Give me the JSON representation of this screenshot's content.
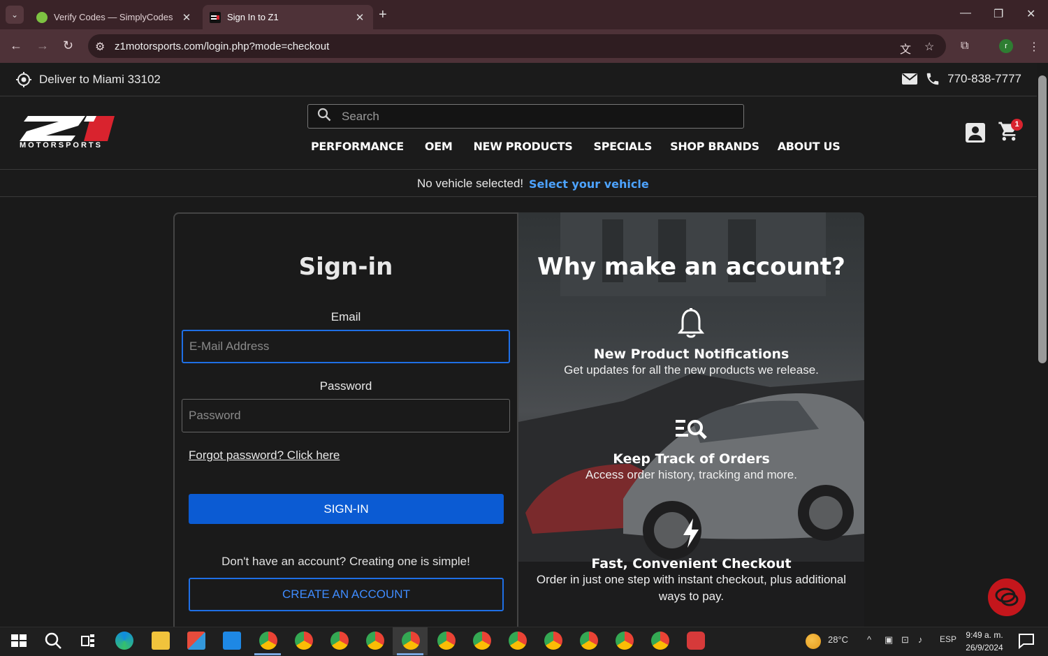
{
  "browser": {
    "tabs": [
      {
        "title": "Verify Codes — SimplyCodes",
        "active": false
      },
      {
        "title": "Sign In to Z1",
        "active": true
      }
    ],
    "url": "z1motorsports.com/login.php?mode=checkout",
    "profile_initial": "r"
  },
  "site": {
    "deliver_to": "Deliver to Miami 33102",
    "phone": "770-838-7777",
    "logo_text": "MOTORSPORTS",
    "search_placeholder": "Search",
    "nav": [
      "PERFORMANCE",
      "OEM",
      "NEW PRODUCTS",
      "SPECIALS",
      "SHOP BRANDS",
      "ABOUT US"
    ],
    "cart_count": "1",
    "vehicle": {
      "status": "No vehicle selected!",
      "link": "Select your vehicle"
    }
  },
  "signin": {
    "title": "Sign-in",
    "email_label": "Email",
    "email_placeholder": "E-Mail Address",
    "password_label": "Password",
    "password_placeholder": "Password",
    "forgot": "Forgot password? Click here",
    "signin_button": "SIGN-IN",
    "no_account": "Don't have an account? Creating one is simple!",
    "create_button": "CREATE AN ACCOUNT"
  },
  "why": {
    "title": "Why make an account?",
    "features": [
      {
        "icon": "bell-icon",
        "title": "New Product Notifications",
        "desc": "Get updates for all the new products we release."
      },
      {
        "icon": "order-search-icon",
        "title": "Keep Track of Orders",
        "desc": "Access order history, tracking and more."
      },
      {
        "icon": "lightning-icon",
        "title": "Fast, Convenient Checkout",
        "desc": "Order in just one step with instant checkout, plus additional ways to pay."
      }
    ]
  },
  "taskbar": {
    "weather": "28°C",
    "language": "ESP",
    "time": "9:49 a. m.",
    "date": "26/9/2024"
  },
  "colors": {
    "accent": "#0b5bd3",
    "link": "#4da3ff",
    "brand_red": "#d9232e",
    "tab_bar": "#3a2328"
  }
}
